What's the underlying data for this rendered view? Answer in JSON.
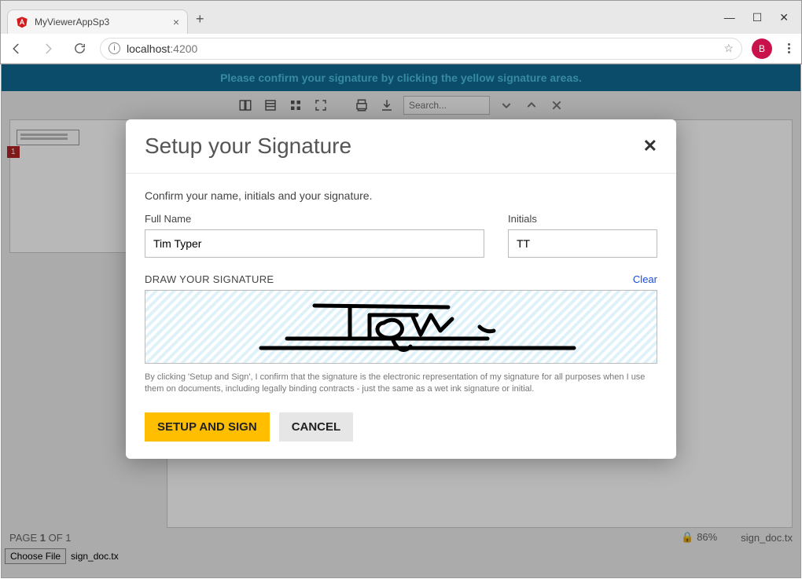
{
  "browser": {
    "tab_title": "MyViewerAppSp3",
    "url_host": "localhost",
    "url_port": ":4200",
    "avatar_letter": "B"
  },
  "app": {
    "banner_text": "Please confirm your signature by clicking the yellow signature areas.",
    "search_placeholder": "Search...",
    "thumb_page_number": "1",
    "status": {
      "page_label_prefix": "PAGE ",
      "page_current": "1",
      "page_label_mid": " OF ",
      "page_total": "1",
      "zoom": "86%",
      "filename_status": "sign_doc.tx"
    },
    "file": {
      "choose_button": "Choose File",
      "filename": "sign_doc.tx"
    }
  },
  "modal": {
    "title": "Setup your Signature",
    "subtitle": "Confirm your name, initials and your signature.",
    "full_name_label": "Full Name",
    "full_name_value": "Tim Typer",
    "initials_label": "Initials",
    "initials_value": "TT",
    "signature_section_label": "DRAW YOUR SIGNATURE",
    "clear_label": "Clear",
    "disclaimer": "By clicking 'Setup and Sign', I confirm that the signature is the electronic representation of my signature for all purposes when I use them on documents, including legally binding contracts - just the same as a wet ink signature or initial.",
    "primary_button": "SETUP AND SIGN",
    "secondary_button": "CANCEL"
  }
}
